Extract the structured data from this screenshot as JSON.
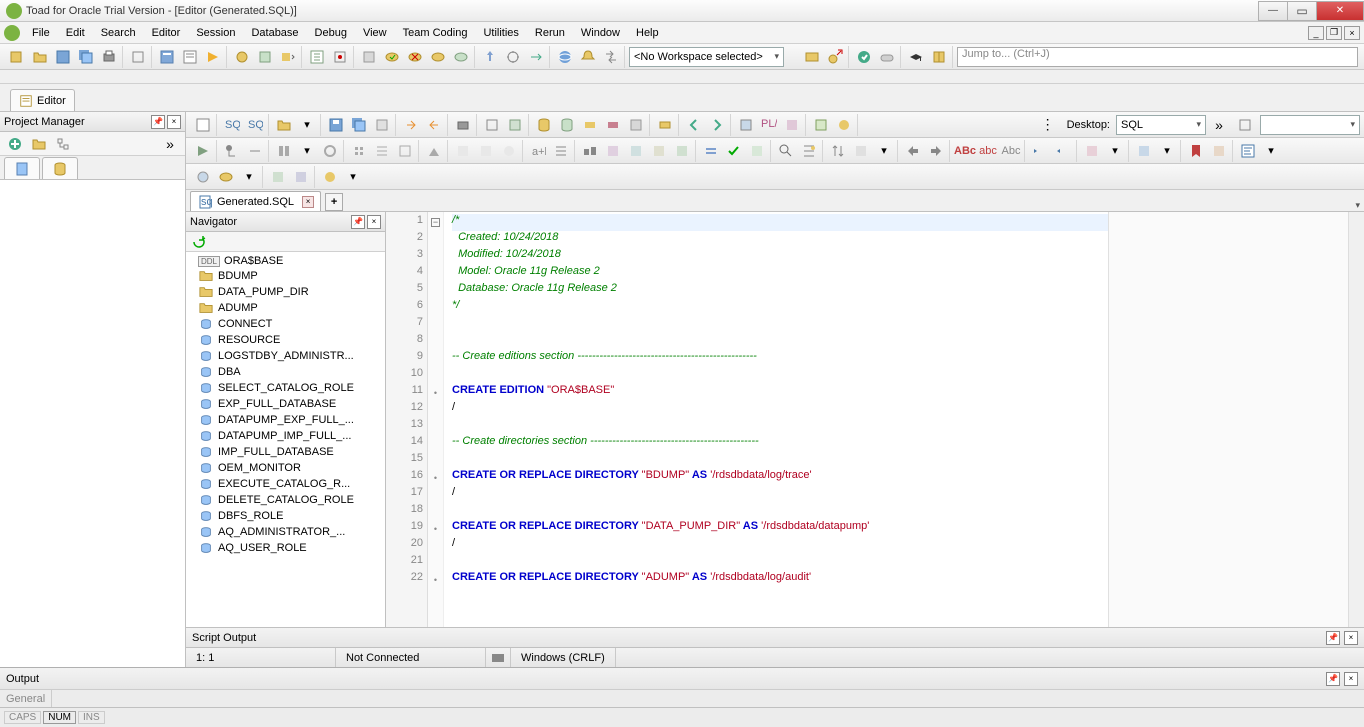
{
  "title": "Toad for Oracle Trial Version - [Editor (Generated.SQL)]",
  "menus": [
    "File",
    "Edit",
    "Search",
    "Editor",
    "Session",
    "Database",
    "Debug",
    "View",
    "Team Coding",
    "Utilities",
    "Rerun",
    "Window",
    "Help"
  ],
  "workspace_combo": "<No Workspace selected>",
  "jump_placeholder": "Jump to... (Ctrl+J)",
  "desktop_label": "Desktop:",
  "desktop_value": "SQL",
  "editor_tab": "Editor",
  "project_manager_title": "Project Manager",
  "doc_tab_name": "Generated.SQL",
  "navigator_title": "Navigator",
  "nav_items": [
    {
      "type": "ddl",
      "label": "ORA$BASE"
    },
    {
      "type": "folder",
      "label": "BDUMP"
    },
    {
      "type": "folder",
      "label": "DATA_PUMP_DIR"
    },
    {
      "type": "folder",
      "label": "ADUMP"
    },
    {
      "type": "role",
      "label": "CONNECT"
    },
    {
      "type": "role",
      "label": "RESOURCE"
    },
    {
      "type": "role",
      "label": "LOGSTDBY_ADMINISTR..."
    },
    {
      "type": "role",
      "label": "DBA"
    },
    {
      "type": "role",
      "label": "SELECT_CATALOG_ROLE"
    },
    {
      "type": "role",
      "label": "EXP_FULL_DATABASE"
    },
    {
      "type": "role",
      "label": "DATAPUMP_EXP_FULL_..."
    },
    {
      "type": "role",
      "label": "DATAPUMP_IMP_FULL_..."
    },
    {
      "type": "role",
      "label": "IMP_FULL_DATABASE"
    },
    {
      "type": "role",
      "label": "OEM_MONITOR"
    },
    {
      "type": "role",
      "label": "EXECUTE_CATALOG_R..."
    },
    {
      "type": "role",
      "label": "DELETE_CATALOG_ROLE"
    },
    {
      "type": "role",
      "label": "DBFS_ROLE"
    },
    {
      "type": "role",
      "label": "AQ_ADMINISTRATOR_..."
    },
    {
      "type": "role",
      "label": "AQ_USER_ROLE"
    }
  ],
  "code": {
    "l1": "/*",
    "l2": "  Created: 10/24/2018",
    "l3": "  Modified: 10/24/2018",
    "l4": "  Model: Oracle 11g Release 2",
    "l5": "  Database: Oracle 11g Release 2",
    "l6": "*/",
    "l9_comment": "-- Create editions section -------------------------------------------------",
    "l11_create": "CREATE ",
    "l11_edition": "EDITION ",
    "l11_name": "\"ORA$BASE\"",
    "l12": "/",
    "l14_comment": "-- Create directories section ----------------------------------------------",
    "l16_pre": "CREATE OR REPLACE ",
    "l16_dir": "DIRECTORY ",
    "l16_name": "\"BDUMP\"",
    "l16_as": " AS ",
    "l16_path": "'/rdsdbdata/log/trace'",
    "l17": "/",
    "l19_pre": "CREATE OR REPLACE ",
    "l19_dir": "DIRECTORY ",
    "l19_name": "\"DATA_PUMP_DIR\"",
    "l19_as": " AS ",
    "l19_path": "'/rdsdbdata/datapump'",
    "l20": "/",
    "l22_pre": "CREATE OR REPLACE ",
    "l22_dir": "DIRECTORY ",
    "l22_name": "\"ADUMP\"",
    "l22_as": " AS ",
    "l22_path": "'/rdsdbdata/log/audit'"
  },
  "script_output_title": "Script Output",
  "status_pos": "1:  1",
  "status_conn": "Not Connected",
  "status_eol": "Windows (CRLF)",
  "output_title": "Output",
  "output_tab": "General",
  "caps": "CAPS",
  "num": "NUM",
  "ins": "INS"
}
